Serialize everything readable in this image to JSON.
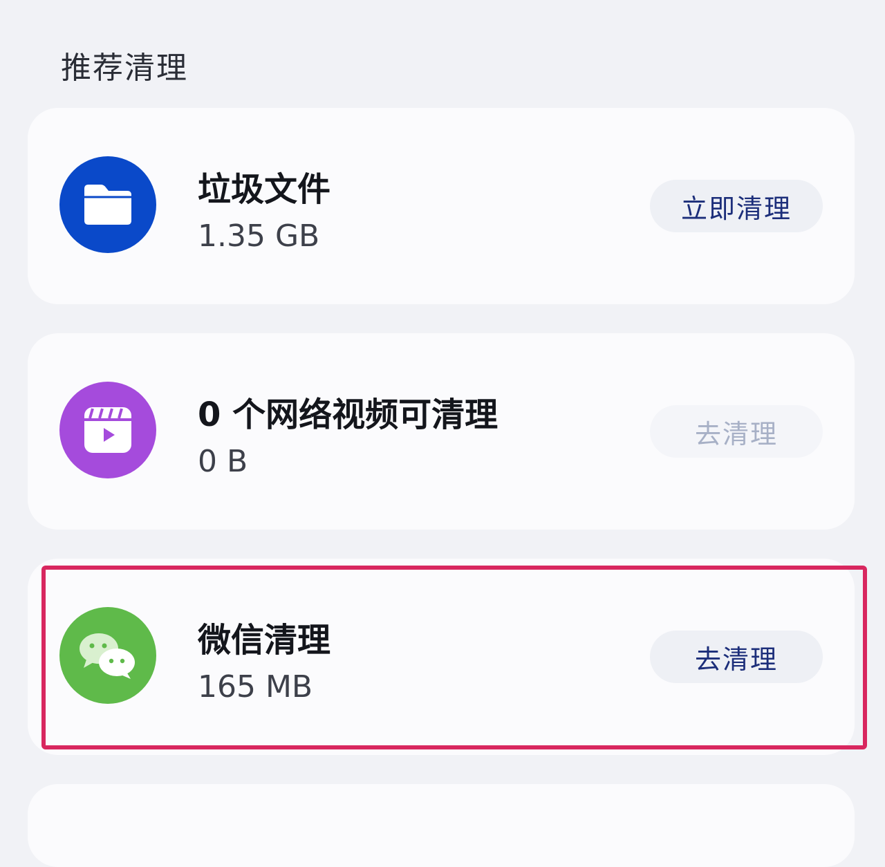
{
  "section": {
    "title": "推荐清理"
  },
  "items": [
    {
      "title": "垃圾文件",
      "size": "1.35 GB",
      "action": "立即清理",
      "icon": "folder-icon",
      "color": "#0a49c9"
    },
    {
      "title": "0 个网络视频可清理",
      "size": "0 B",
      "action": "去清理",
      "icon": "video-icon",
      "color": "#a54bdc",
      "action_disabled": true
    },
    {
      "title": "微信清理",
      "size": "165 MB",
      "action": "去清理",
      "icon": "wechat-icon",
      "color": "#5fba4a"
    }
  ],
  "colors": {
    "background": "#f1f2f6",
    "card": "#fbfbfd",
    "highlight": "#d8275f",
    "button_text": "#1c2e7a"
  }
}
